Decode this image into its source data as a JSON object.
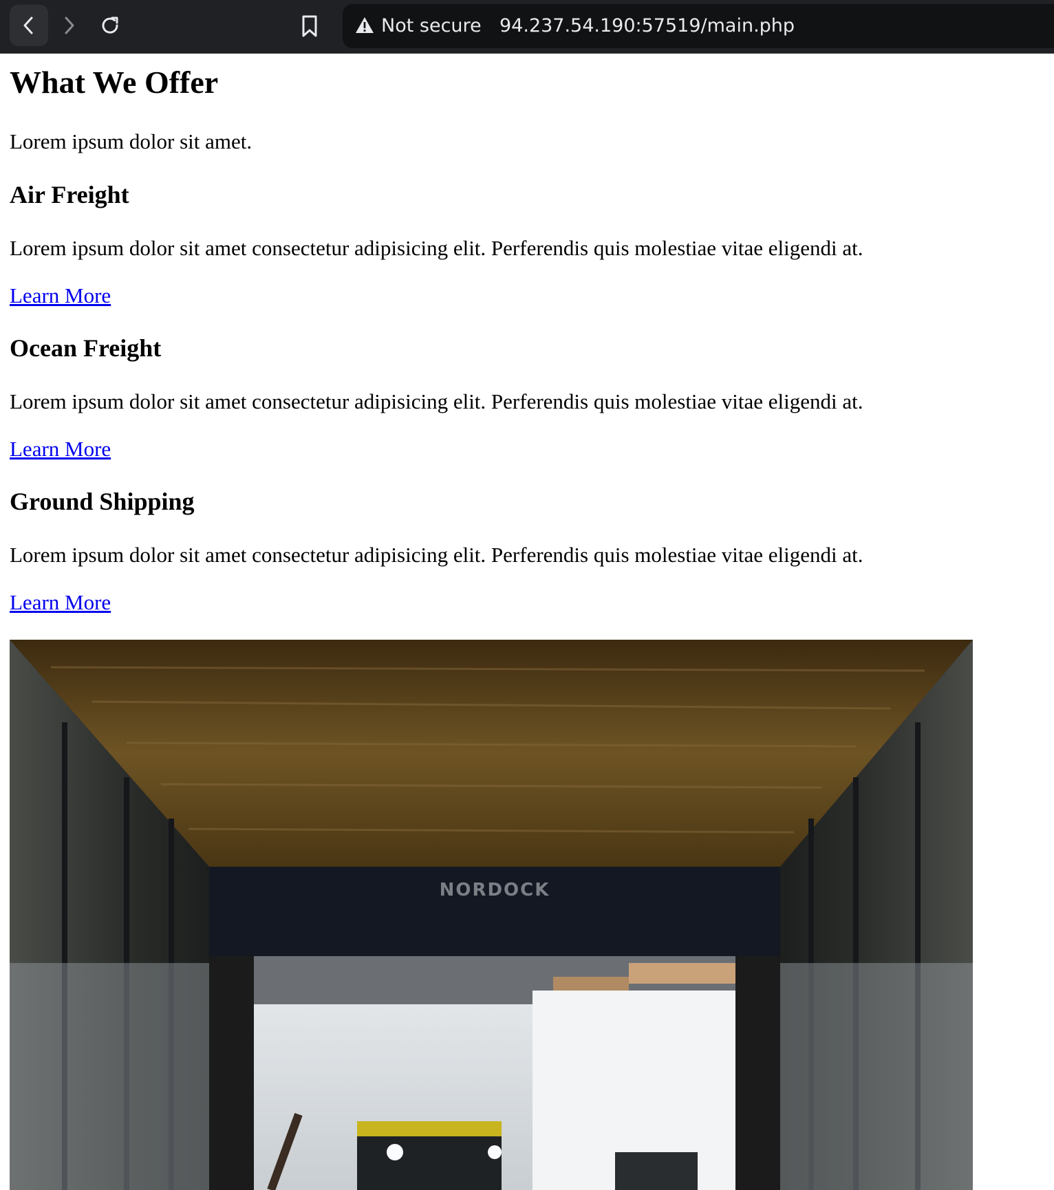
{
  "browser": {
    "security_label": "Not secure",
    "url": "94.237.54.190:57519/main.php"
  },
  "page": {
    "title": "What We Offer",
    "intro": "Lorem ipsum dolor sit amet.",
    "services": [
      {
        "title": "Air Freight",
        "description": "Lorem ipsum dolor sit amet consectetur adipisicing elit. Perferendis quis molestiae vitae eligendi at.",
        "link": "Learn More"
      },
      {
        "title": "Ocean Freight",
        "description": "Lorem ipsum dolor sit amet consectetur adipisicing elit. Perferendis quis molestiae vitae eligendi at.",
        "link": "Learn More"
      },
      {
        "title": "Ground Shipping",
        "description": "Lorem ipsum dolor sit amet consectetur adipisicing elit. Perferendis quis molestiae vitae eligendi at.",
        "link": "Learn More"
      }
    ],
    "hero_image": {
      "sign_text": "NORDOCK"
    }
  },
  "colors": {
    "chrome_bg": "#202124",
    "omnibox_bg": "#111214",
    "link": "#0000ee"
  }
}
